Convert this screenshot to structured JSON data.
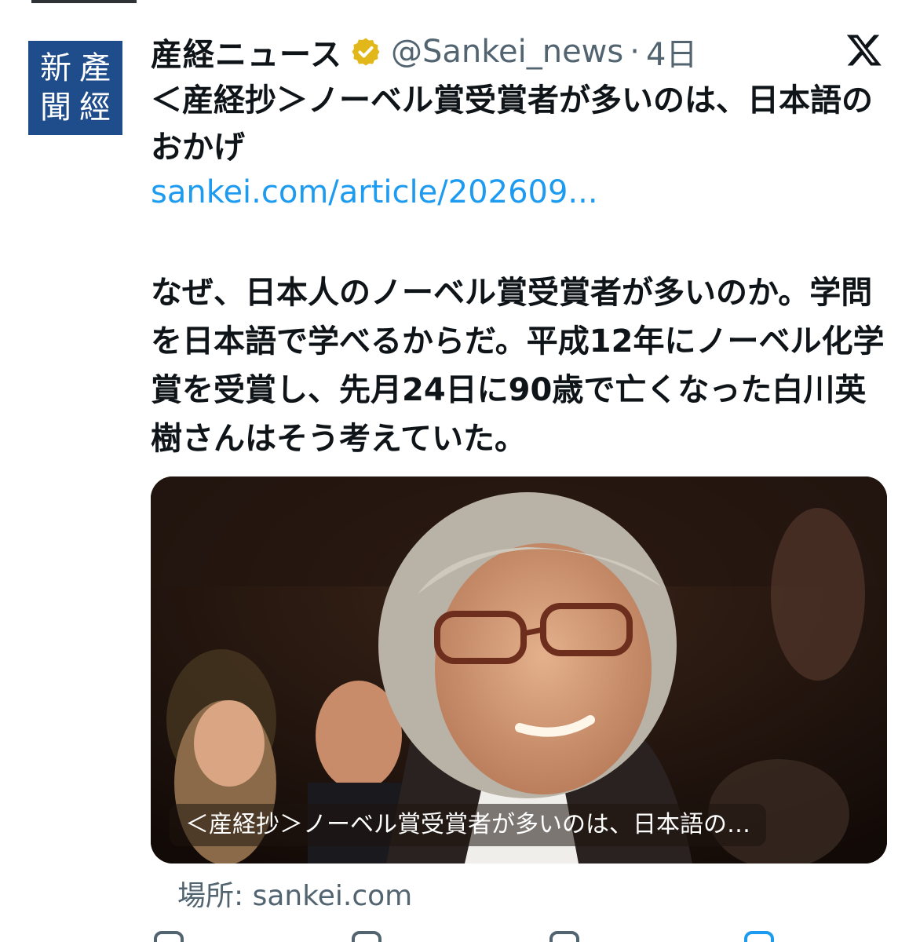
{
  "tweet": {
    "display_name": "産経ニュース",
    "handle": "@Sankei_news",
    "separator": "·",
    "time": "4日",
    "avatar_seal": [
      "產",
      "新",
      "經",
      "聞"
    ],
    "headline": "＜産経抄＞ノーベル賞受賞者が多いのは、日本語のおかげ",
    "link": "sankei.com/article/202609...",
    "body": "なぜ、日本人のノーベル賞受賞者が多いのか。学問を日本語で学べるからだ。平成12年にノーベル化学賞を受賞し、先月24日に90歳で亡くなった白川英樹さんはそう考えていた。",
    "media_caption": "＜産経抄＞ノーベル賞受賞者が多いのは、日本語の…",
    "source": "場所: sankei.com"
  },
  "colors": {
    "link": "#1d9bf0",
    "secondary_text": "#536471",
    "verified_badge": "#e2b719",
    "avatar_bg": "#1f4d8c"
  },
  "icons": [
    "verified-badge-icon",
    "x-logo-icon",
    "reply-icon",
    "retweet-icon",
    "like-icon",
    "share-icon"
  ]
}
